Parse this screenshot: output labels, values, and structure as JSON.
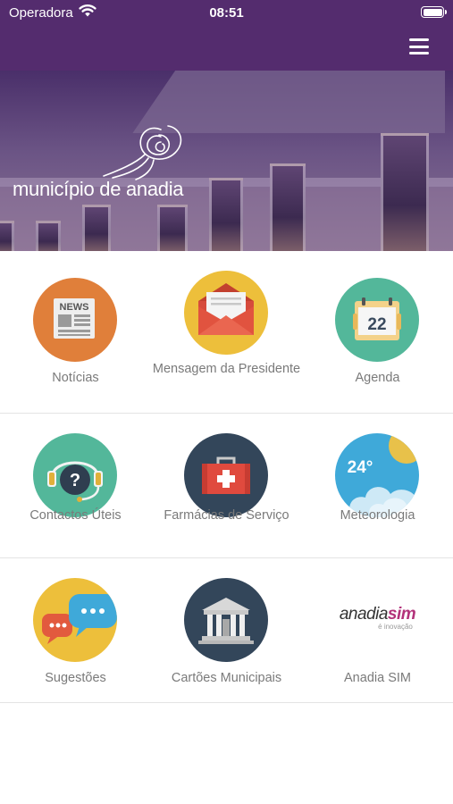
{
  "status_bar": {
    "carrier": "Operadora",
    "time": "08:51"
  },
  "header": {
    "brand": "município de anadia",
    "menu_icon": "hamburger-menu-icon"
  },
  "colors": {
    "header_bg": "#542c6e",
    "label_text": "#7a7a7a",
    "divider": "#e4e4e4"
  },
  "menu": [
    {
      "label": "Notícias",
      "icon": "newspaper-icon",
      "color": "#e07f3a"
    },
    {
      "label": "Mensagem da Presidente",
      "icon": "envelope-icon",
      "color": "#edbf3b"
    },
    {
      "label": "Agenda",
      "icon": "calendar-icon",
      "color": "#53b79a",
      "calendar_day": "22"
    },
    {
      "label": "Contactos Úteis",
      "icon": "headset-icon",
      "color": "#53b79a"
    },
    {
      "label": "Farmácias de Serviço",
      "icon": "first-aid-kit-icon",
      "color": "#33465a"
    },
    {
      "label": "Meteorologia",
      "icon": "weather-icon",
      "color": "#3fa9d9",
      "temperature": "24°"
    },
    {
      "label": "Sugestões",
      "icon": "chat-bubbles-icon",
      "color": "#edbf3b"
    },
    {
      "label": "Cartões Municipais",
      "icon": "municipal-building-icon",
      "color": "#33465a"
    },
    {
      "label": "Anadia SIM",
      "icon": "anadia-sim-logo",
      "logo_text_main": "anadia",
      "logo_text_accent": "sim",
      "logo_tagline": "é inovação"
    }
  ]
}
